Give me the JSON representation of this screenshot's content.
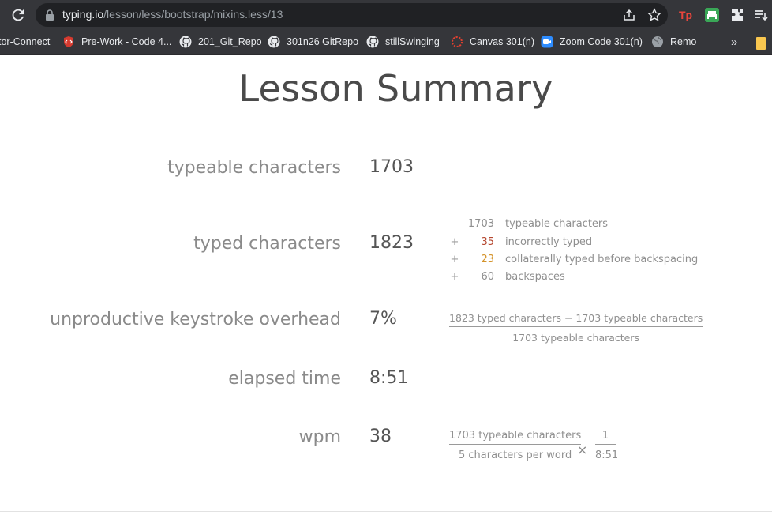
{
  "browser": {
    "url_host": "typing.io",
    "url_path": "/lesson/less/bootstrap/mixins.less/13",
    "bookmarks": [
      {
        "label": "tor-Connect",
        "icon": "none"
      },
      {
        "label": "Pre-Work - Code 4...",
        "icon": "code-shield-icon"
      },
      {
        "label": "201_Git_Repo",
        "icon": "github-icon"
      },
      {
        "label": "301n26 GitRepo",
        "icon": "github-icon"
      },
      {
        "label": "stillSwinging",
        "icon": "github-icon"
      },
      {
        "label": "Canvas 301(n)",
        "icon": "canvas-icon"
      },
      {
        "label": "Zoom Code 301(n)",
        "icon": "zoom-icon"
      },
      {
        "label": "Remo",
        "icon": "globe-icon"
      }
    ],
    "overflow_label": "»",
    "extension_label": "Tp"
  },
  "page": {
    "title": "Lesson Summary",
    "stats": [
      {
        "label": "typeable characters",
        "value": "1703"
      },
      {
        "label": "typed characters",
        "value": "1823"
      },
      {
        "label": "unproductive keystroke overhead",
        "value": "7%"
      },
      {
        "label": "elapsed time",
        "value": "8:51"
      },
      {
        "label": "wpm",
        "value": "38"
      }
    ],
    "breakdown": [
      {
        "op": "",
        "num": "1703",
        "text": "typeable characters"
      },
      {
        "op": "+",
        "num": "35",
        "text": "incorrectly typed"
      },
      {
        "op": "+",
        "num": "23",
        "text": "collaterally typed before backspacing"
      },
      {
        "op": "+",
        "num": "60",
        "text": "backspaces"
      }
    ],
    "overhead_formula": {
      "numerator": "1823 typed characters − 1703 typeable characters",
      "denominator": "1703 typeable characters"
    },
    "wpm_formula": {
      "left_numerator": "1703 typeable characters",
      "left_denominator": "5 characters per word",
      "operator": "×",
      "right_numerator": "1",
      "right_denominator": "8:51"
    }
  }
}
